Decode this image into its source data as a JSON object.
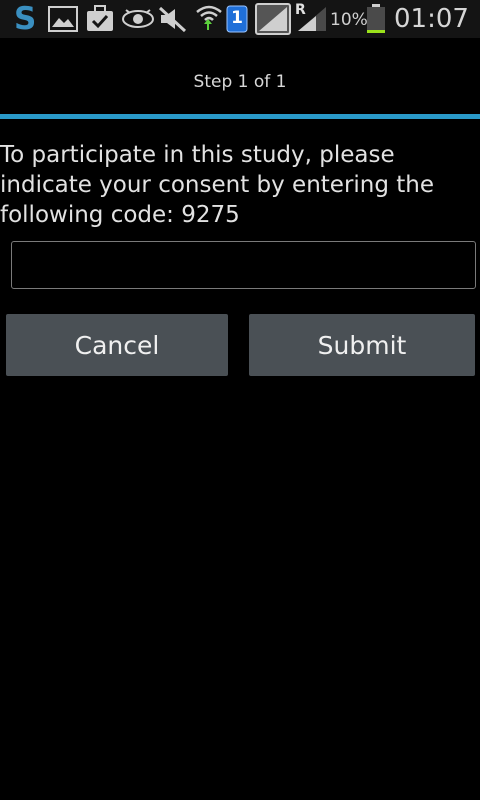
{
  "status_bar": {
    "icons": [
      "s-icon",
      "gallery-icon",
      "briefcase-check-icon",
      "eye-icon",
      "mute-icon",
      "wifi-icon",
      "notification-badge-icon",
      "signal-sim-icon",
      "signal-bars-icon",
      "battery-icon"
    ],
    "badge_count": "1",
    "roaming": "R",
    "battery_percent": "10%",
    "time": "01:07",
    "accent_color": "#2a9ac9",
    "battery_level": 0.1
  },
  "header": {
    "step_title": "Step 1 of 1"
  },
  "form": {
    "instructions": "To participate in this study, please indicate your consent by entering the following code:  9275",
    "code_value": ""
  },
  "buttons": {
    "cancel_label": "Cancel",
    "submit_label": "Submit"
  }
}
